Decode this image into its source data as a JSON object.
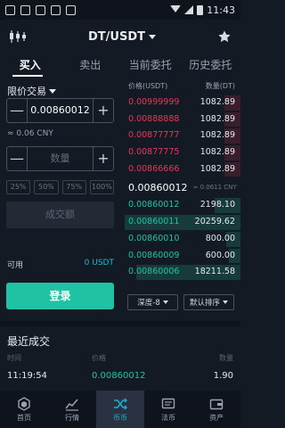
{
  "status_bar": {
    "time": "11:43"
  },
  "header": {
    "pair": "DT/USDT"
  },
  "tabs": [
    {
      "label": "买入",
      "active": true
    },
    {
      "label": "卖出",
      "active": false
    },
    {
      "label": "当前委托",
      "active": false
    },
    {
      "label": "历史委托",
      "active": false
    }
  ],
  "form": {
    "order_type": "限价交易",
    "price_value": "0.00860012",
    "price_cny": "≈ 0.06 CNY",
    "quantity_placeholder": "数量",
    "percent_options": [
      "25%",
      "50%",
      "75%",
      "100%"
    ],
    "amount_label": "成交额",
    "available_label": "可用",
    "available_value": "0 USDT",
    "login_button": "登录",
    "minus": "—",
    "plus": "+"
  },
  "order_book": {
    "price_header": "价格(USDT)",
    "quantity_header": "数量(DT)",
    "asks": [
      {
        "price": "0.00999999",
        "qty": "1082.89",
        "depth": 0.14
      },
      {
        "price": "0.00888888",
        "qty": "1082.89",
        "depth": 0.14
      },
      {
        "price": "0.00877777",
        "qty": "1082.89",
        "depth": 0.14
      },
      {
        "price": "0.00877775",
        "qty": "1082.89",
        "depth": 0.14
      },
      {
        "price": "0.00866666",
        "qty": "1082.89",
        "depth": 0.14
      }
    ],
    "last_price": "0.00860012",
    "last_price_cny": "≈ 0.0611 CNY",
    "bids": [
      {
        "price": "0.00860012",
        "qty": "2198.10",
        "depth": 0.22
      },
      {
        "price": "0.00860011",
        "qty": "20259.62",
        "depth": 1.0
      },
      {
        "price": "0.00860010",
        "qty": "800.00",
        "depth": 0.12
      },
      {
        "price": "0.00860009",
        "qty": "600.00",
        "depth": 0.1
      },
      {
        "price": "0.00860006",
        "qty": "18211.58",
        "depth": 0.9
      }
    ],
    "depth_select": "深度-8",
    "sort_select": "默认排序"
  },
  "recent_trades": {
    "title": "最近成交",
    "headers": {
      "time": "时间",
      "price": "价格",
      "amount": "数量"
    },
    "rows": [
      {
        "time": "11:19:54",
        "price": "0.00860012",
        "amount": "1.90"
      }
    ]
  },
  "nav": [
    {
      "label": "首页",
      "icon": "home-icon",
      "active": false
    },
    {
      "label": "行情",
      "icon": "market-chart-icon",
      "active": false
    },
    {
      "label": "币币",
      "icon": "exchange-icon",
      "active": true
    },
    {
      "label": "法币",
      "icon": "fiat-icon",
      "active": false
    },
    {
      "label": "资产",
      "icon": "wallet-icon",
      "active": false
    }
  ],
  "colors": {
    "background": "#141a24",
    "ask": "#e8365a",
    "bid": "#1fc3a4",
    "accent": "#19b0d2",
    "button": "#1fc3a4"
  }
}
